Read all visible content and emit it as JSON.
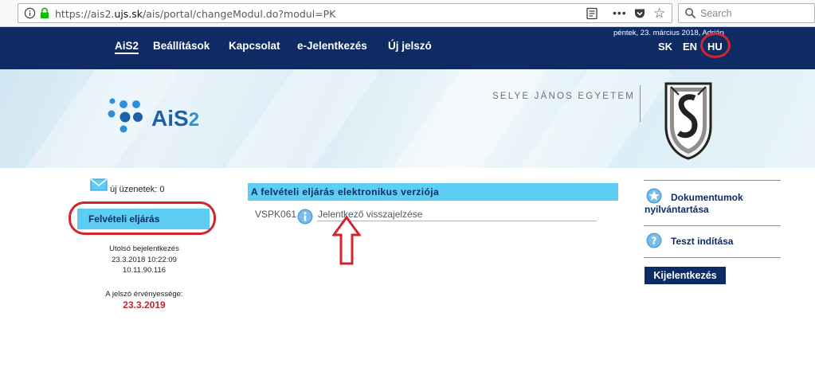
{
  "browser": {
    "url_prefix": "https://ais2.",
    "url_domain": "ujs.sk",
    "url_path": "/ais/portal/changeModul.do?modul=PK",
    "more_label": "•••",
    "star_label": "☆",
    "search_placeholder": "Search"
  },
  "topnav": {
    "items": [
      "AiS2",
      "Beállítások",
      "Kapcsolat",
      "e-Jelentkezés",
      "Új jelszó"
    ],
    "date": "péntek, 23. március 2018, Adrián",
    "languages": [
      "SK",
      "EN",
      "HU"
    ]
  },
  "banner": {
    "logo_main": "AiS",
    "logo_sub": "2",
    "university": "SELYE JÁNOS EGYETEM"
  },
  "left": {
    "messages": "új üzenetek: 0",
    "menu_item": "Felvételi eljárás",
    "last_login_label": "Utolsó bejelentkezés",
    "last_login_time": "23.3.2018 10:22:09",
    "last_login_ip": "10.11.90.116",
    "password_valid_label": "A jelszó érvényessége:",
    "password_valid_date": "23.3.2019"
  },
  "center": {
    "section_title": "A felvételi eljárás elektronikus verziója",
    "apps": [
      {
        "code": "VSPK061",
        "label": "Jelentkező visszajelzése"
      }
    ]
  },
  "right": {
    "documents": "Dokumentumok nyilvántartása",
    "test": "Teszt indítása",
    "logout": "Kijelentkezés"
  },
  "colors": {
    "navy": "#0f2b63",
    "accent": "#5ecdf3",
    "highlight_red": "#d0262d"
  }
}
